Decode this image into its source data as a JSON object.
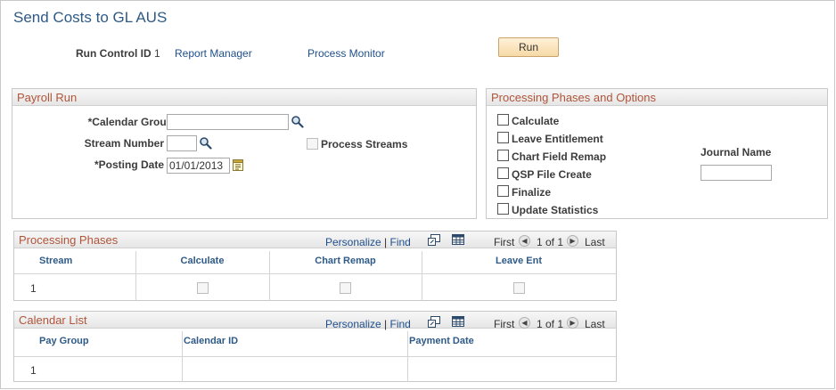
{
  "page": {
    "title": "Send Costs to GL AUS"
  },
  "run_control": {
    "label": "Run Control ID",
    "value": "1",
    "report_manager": "Report Manager",
    "process_monitor": "Process Monitor",
    "run_button": "Run"
  },
  "payroll_run": {
    "title": "Payroll Run",
    "calendar_group_label": "*Calendar Group",
    "calendar_group_value": "",
    "stream_number_label": "Stream Number",
    "stream_number_value": "",
    "process_streams_label": "Process Streams",
    "posting_date_label": "*Posting Date",
    "posting_date_value": "01/01/2013"
  },
  "phases_options": {
    "title": "Processing Phases and Options",
    "options": [
      "Calculate",
      "Leave Entitlement",
      "Chart Field Remap",
      "QSP File Create",
      "Finalize",
      "Update Statistics"
    ],
    "journal_name_label": "Journal Name",
    "journal_name_value": ""
  },
  "grid_nav": {
    "personalize": "Personalize",
    "separator": "|",
    "find": "Find",
    "first": "First",
    "range": "1 of 1",
    "last": "Last"
  },
  "processing_phases": {
    "title": "Processing Phases",
    "columns": [
      "Stream",
      "Calculate",
      "Chart Remap",
      "Leave Ent"
    ],
    "rows": [
      {
        "num": "1"
      }
    ]
  },
  "calendar_list": {
    "title": "Calendar List",
    "columns": [
      "Pay Group",
      "Calendar ID",
      "Payment Date"
    ],
    "rows": [
      {
        "num": "1"
      }
    ]
  },
  "colors": {
    "title": "#2e5a87",
    "section_title": "#b0553a",
    "link": "#1f4f8c",
    "button": "#f6d9a6"
  },
  "icons": [
    "search-icon",
    "calendar-icon",
    "zoom-grid-icon",
    "spreadsheet-icon",
    "prev-arrow-icon",
    "next-arrow-icon"
  ]
}
